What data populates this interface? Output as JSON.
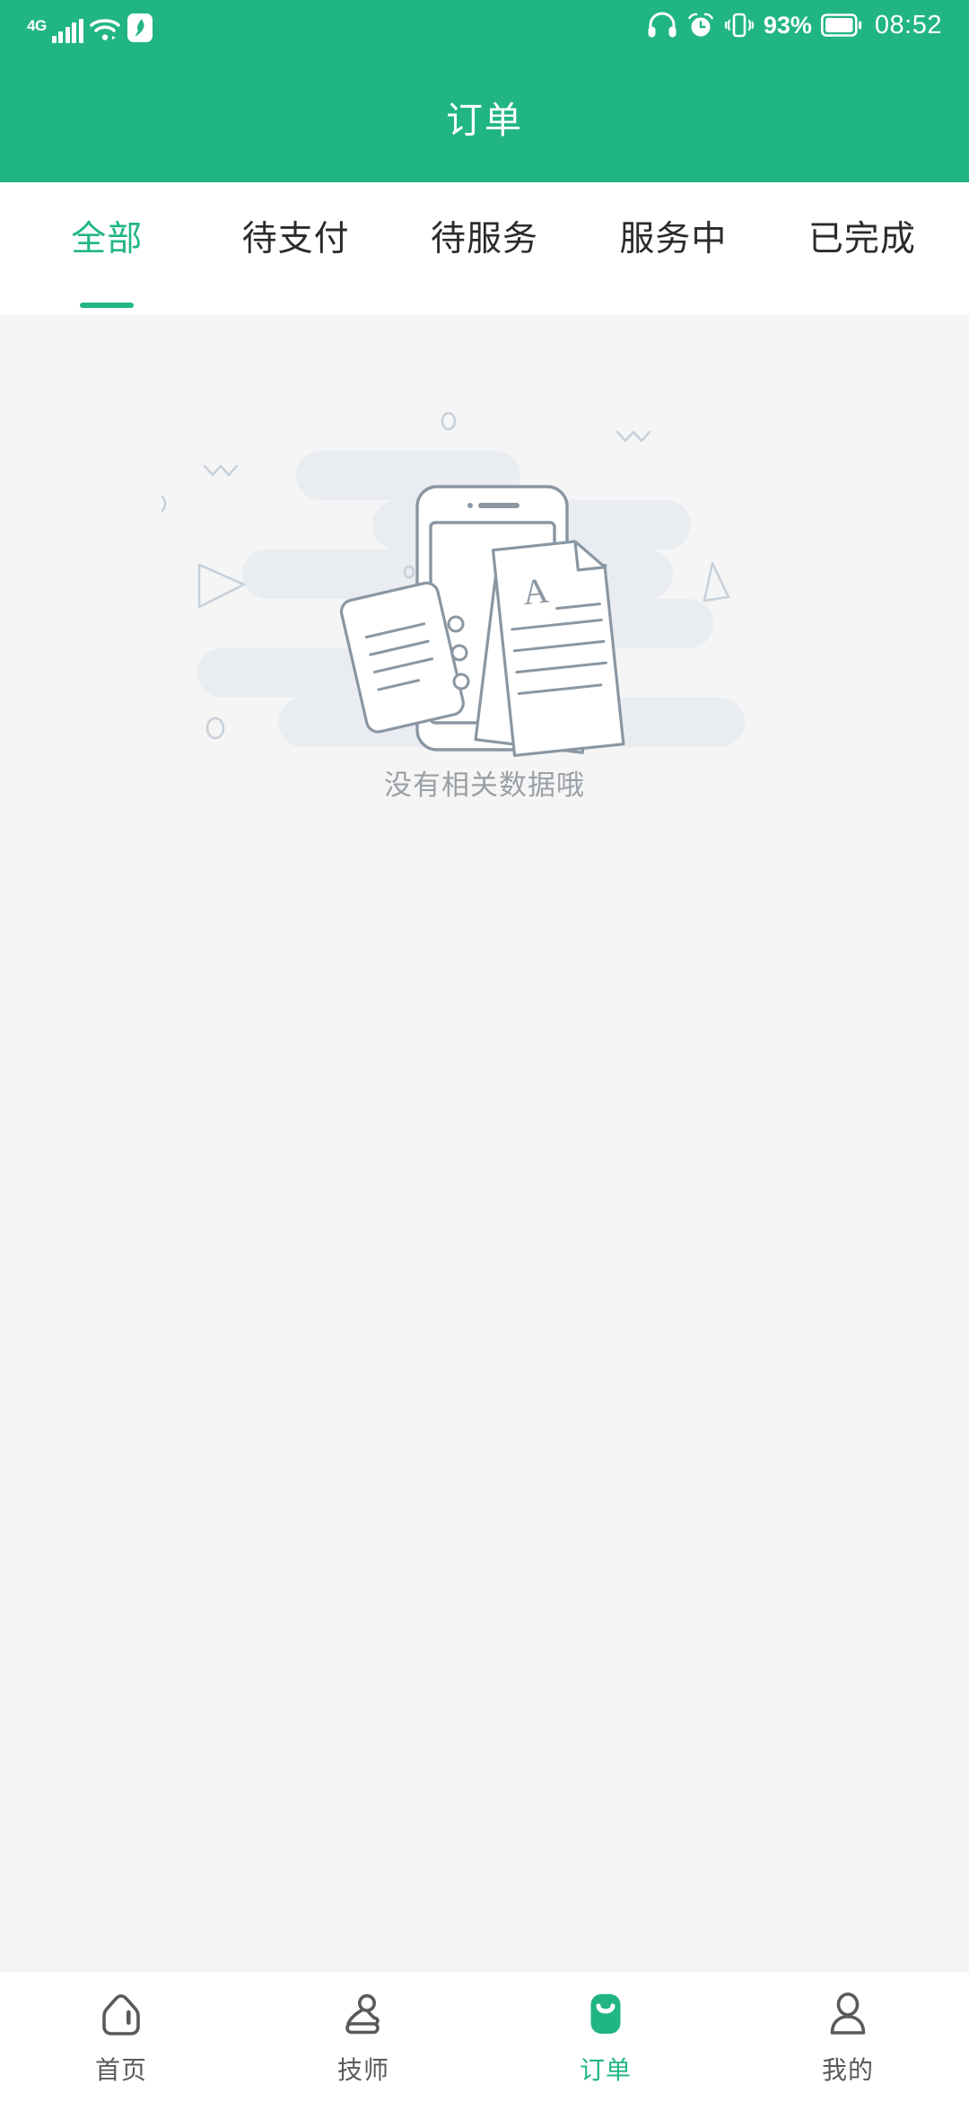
{
  "theme": {
    "accent": "#21b586",
    "header_bg": "#21b586",
    "content_bg": "#f5f5f5",
    "nav_bg": "#ffffff",
    "inactive_text": "#2b2b2b",
    "empty_text_color": "#9aa0a6",
    "illustration_line": "#8a97a3",
    "illustration_blob": "#e9edf1"
  },
  "statusbar": {
    "network": "4G",
    "signal_icon": "signal-bars-icon",
    "wifi_icon": "wifi-icon",
    "vpn_icon": "vpn-shield-icon",
    "headset_icon": "headphones-icon",
    "alarm_icon": "alarm-clock-icon",
    "vibrate_icon": "vibrate-icon",
    "battery_percent": "93%",
    "battery_icon": "battery-icon",
    "time": "08:52"
  },
  "header": {
    "title": "订单"
  },
  "tabs": {
    "active_index": 0,
    "items": [
      {
        "label": "全部"
      },
      {
        "label": "待支付"
      },
      {
        "label": "待服务"
      },
      {
        "label": "服务中"
      },
      {
        "label": "已完成"
      }
    ]
  },
  "empty_state": {
    "illustration": "no-data-documents-phone-illustration",
    "message": "没有相关数据哦"
  },
  "bottom_nav": {
    "active_index": 2,
    "items": [
      {
        "label": "首页",
        "icon": "home-icon"
      },
      {
        "label": "技师",
        "icon": "technician-icon"
      },
      {
        "label": "订单",
        "icon": "orders-bag-icon"
      },
      {
        "label": "我的",
        "icon": "profile-person-icon"
      }
    ]
  }
}
